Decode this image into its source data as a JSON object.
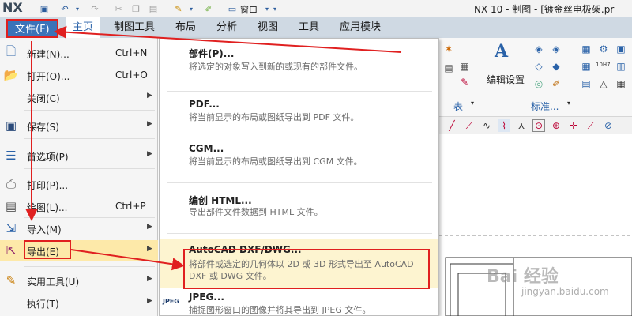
{
  "app": {
    "logo": "NX",
    "window_title": "NX 10 - 制图 - [镀金丝电极架.pr",
    "window_menu": "窗口"
  },
  "tabs": [
    {
      "label": "文件(F)"
    },
    {
      "label": "主页"
    },
    {
      "label": "制图工具"
    },
    {
      "label": "布局"
    },
    {
      "label": "分析"
    },
    {
      "label": "视图"
    },
    {
      "label": "工具"
    },
    {
      "label": "应用模块"
    }
  ],
  "file_menu": {
    "items": [
      {
        "label": "新建(N)...",
        "shortcut": "Ctrl+N",
        "icon": "new-file-icon"
      },
      {
        "label": "打开(O)...",
        "shortcut": "Ctrl+O",
        "icon": "open-folder-icon"
      },
      {
        "label": "关闭(C)",
        "icon": "none"
      },
      {
        "label": "保存(S)",
        "icon": "save-icon"
      },
      {
        "label": "首选项(P)",
        "icon": "preferences-icon"
      },
      {
        "label": "打印(P)...",
        "icon": "printer-icon"
      },
      {
        "label": "绘图(L)...",
        "shortcut": "Ctrl+P",
        "icon": "plot-icon"
      },
      {
        "label": "导入(M)",
        "icon": "import-icon"
      },
      {
        "label": "导出(E)",
        "icon": "export-icon"
      },
      {
        "label": "实用工具(U)",
        "icon": "utilities-icon"
      },
      {
        "label": "执行(T)",
        "icon": "none"
      }
    ]
  },
  "export_submenu": {
    "items": [
      {
        "title": "部件(P)...",
        "desc": "将选定的对象写入到新的或现有的部件文件。"
      },
      {
        "title": "PDF...",
        "desc": "将当前显示的布局或图纸导出到 PDF 文件。"
      },
      {
        "title": "CGM...",
        "desc": "将当前显示的布局或图纸导出到 CGM 文件。"
      },
      {
        "title": "编创 HTML...",
        "desc": "导出部件文件数据到 HTML 文件。"
      },
      {
        "title": "AutoCAD DXF/DWG...",
        "desc": "将部件或选定的几何体以 2D 或 3D 形式导出至 AutoCAD DXF 或 DWG 文件。"
      },
      {
        "title": "JPEG...",
        "desc": "捕捉图形窗口的图像并将其导出到 JPEG 文件。",
        "icon_text": "JPEG"
      }
    ]
  },
  "ribbon": {
    "edit_settings": "编辑设置",
    "table_group": "表",
    "standard_group": "标准...",
    "icon_10h7": "10H7"
  },
  "watermark": {
    "brand": "Bai 经验",
    "url": "jingyan.baidu.com"
  },
  "colors": {
    "file_tab": "#3b73b9",
    "tab_bar": "#cfd9e3",
    "highlight": "#fde9a9",
    "annotation_red": "#e02020"
  }
}
